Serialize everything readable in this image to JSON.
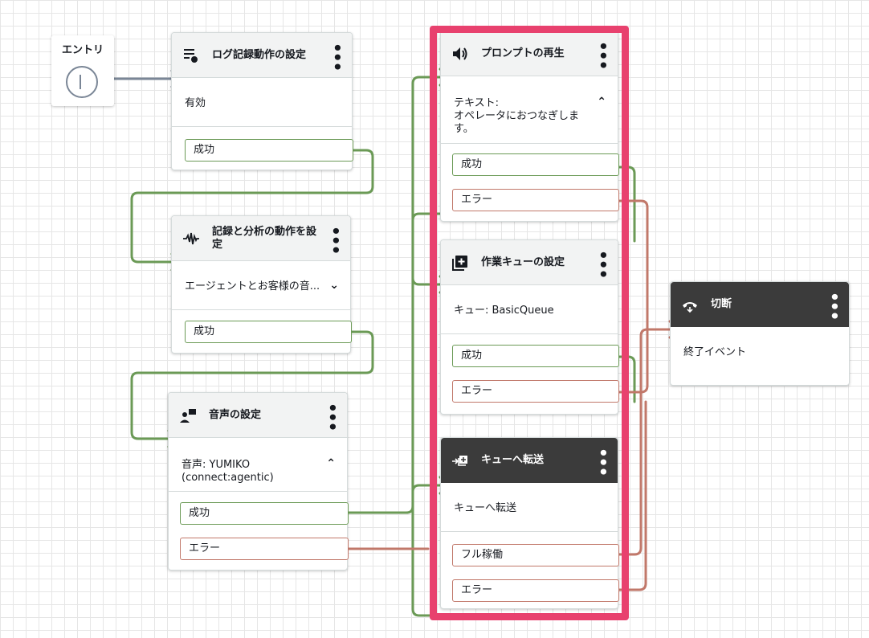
{
  "entry": {
    "label": "エントリ"
  },
  "blocks": {
    "logging": {
      "title": "ログ記録動作の設定",
      "status": "有効",
      "success": "成功",
      "icon": "log-settings-icon"
    },
    "recording": {
      "title": "記録と分析の動作を設定",
      "detail": "エージェントとお客様の音...",
      "success": "成功",
      "icon": "waveform-icon"
    },
    "voice": {
      "title": "音声の設定",
      "detail_line1": "音声: YUMIKO",
      "detail_line2": "(connect:agentic)",
      "success": "成功",
      "error": "エラー",
      "icon": "voice-person-icon"
    },
    "prompt": {
      "title": "プロンプトの再生",
      "text_label": "テキスト:",
      "text_line1": "オペレータにおつなぎしま",
      "text_line2": "す。",
      "success": "成功",
      "error": "エラー",
      "icon": "speaker-icon"
    },
    "queue": {
      "title": "作業キューの設定",
      "queue_value": "キュー: BasicQueue",
      "success": "成功",
      "error": "エラー",
      "icon": "add-queue-icon"
    },
    "transfer": {
      "title": "キューへ転送",
      "detail": "キューへ転送",
      "at_capacity": "フル稼働",
      "error": "エラー",
      "icon": "transfer-queue-icon"
    },
    "disconnect": {
      "title": "切断",
      "detail": "終了イベント",
      "icon": "hang-up-icon"
    }
  },
  "colors": {
    "success_wire": "#6b9a56",
    "error_wire": "#c1786a",
    "entry_wire": "#7a8696",
    "highlight": "#e8416e",
    "dark_header": "#3b3b3b"
  }
}
